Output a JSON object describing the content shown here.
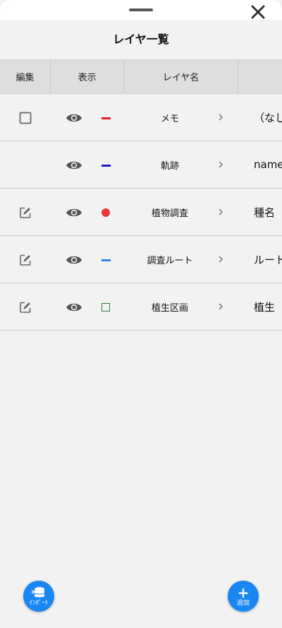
{
  "dialog": {
    "title": "レイヤ一覧"
  },
  "columns": {
    "edit": "編集",
    "show": "表示",
    "name": "レイヤ名"
  },
  "layers": [
    {
      "name": "メモ",
      "field": "（なし",
      "edit": "checkbox",
      "symbol": "line",
      "color": "#e02020"
    },
    {
      "name": "軌跡",
      "field": "name",
      "edit": "none",
      "symbol": "line",
      "color": "#1a1acc"
    },
    {
      "name": "植物調査",
      "field": "種名",
      "edit": "pencil",
      "symbol": "dot",
      "color": "#e53935"
    },
    {
      "name": "調査ルート",
      "field": "ルート",
      "edit": "pencil",
      "symbol": "line",
      "color": "#2a86e0"
    },
    {
      "name": "植生区画",
      "field": "植生",
      "edit": "pencil",
      "symbol": "square",
      "color": "#2e7d32"
    }
  ],
  "buttons": {
    "import_label": "ｲﾝﾎﾟｰﾄ",
    "add_label": "追加"
  }
}
